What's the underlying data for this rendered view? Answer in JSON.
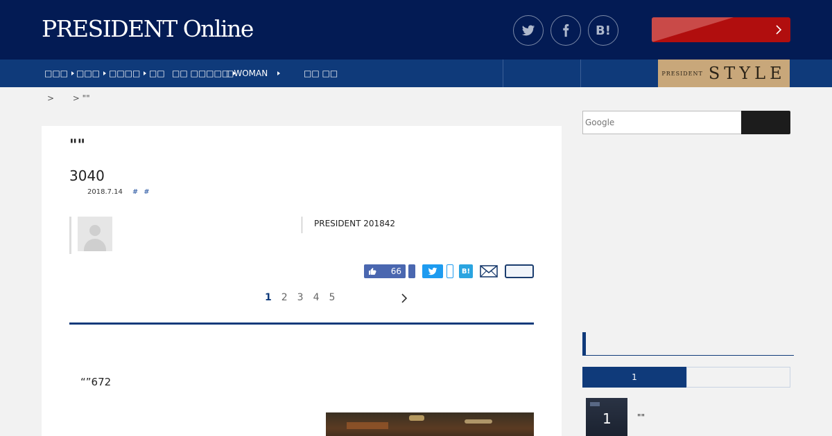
{
  "header": {
    "logo_text": "PRESIDENT Online",
    "social": [
      {
        "icon": "twitter-icon"
      },
      {
        "icon": "facebook-icon"
      },
      {
        "icon": "hatena-bookmark-icon",
        "label": "B!"
      }
    ],
    "cta_label": ""
  },
  "nav": {
    "items": [
      {
        "label": "□□□",
        "has_arrow": true
      },
      {
        "label": "□□□",
        "has_arrow": true
      },
      {
        "label": "□□□□",
        "has_arrow": true
      },
      {
        "label": "□□",
        "has_arrow": false
      },
      {
        "label": "□□ □□□□□",
        "has_arrow": true
      },
      {
        "label": "□WOMAN",
        "has_arrow": true
      },
      {
        "label": "□□ □□",
        "has_arrow": false
      }
    ],
    "style_banner": {
      "small": "PRESIDENT",
      "big": "STYLE"
    }
  },
  "breadcrumb": {
    "text": ">       > \"\""
  },
  "article": {
    "title": "\"\"",
    "subtitle": "3040",
    "date": "2018.7.14",
    "tags": [
      "#",
      "#"
    ],
    "source": "PRESIDENT 201842",
    "share": {
      "fb_count": "66",
      "hatena_label": "B!"
    },
    "pager": [
      "1",
      "2",
      "3",
      "4",
      "5"
    ],
    "pager_active": "1",
    "body_first": "“”672"
  },
  "sidebar": {
    "search_placeholder": "Google",
    "search_button_label": "",
    "ranking": {
      "tabs": [
        "1",
        ""
      ],
      "items": [
        {
          "rank": "1",
          "title": "\"\""
        }
      ]
    }
  },
  "colors": {
    "header_bg": "#031b54",
    "nav_bg": "#0f3a7a",
    "cta_red": "#b10e0e",
    "style_gold": "#c8a77a"
  }
}
